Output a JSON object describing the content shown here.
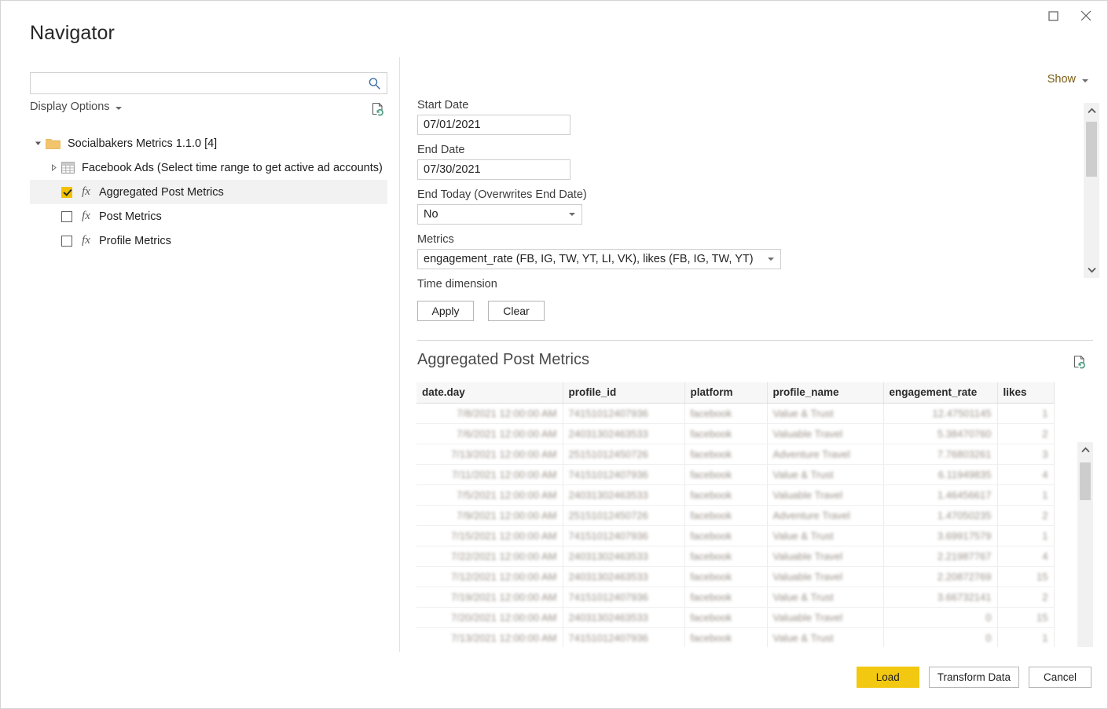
{
  "window": {
    "title": "Navigator",
    "maximize_icon": "maximize-icon",
    "close_icon": "close-icon"
  },
  "left": {
    "search": {
      "value": "",
      "placeholder": "",
      "icon": "search-icon"
    },
    "display_options_label": "Display Options",
    "refresh_icon": "refresh-document-icon",
    "tree": [
      {
        "label": "Socialbakers Metrics 1.1.0 [4]",
        "type": "folder",
        "expanded": true,
        "level": 0,
        "checkbox": false,
        "selected": false
      },
      {
        "label": "Facebook Ads (Select time range to get active ad accounts)",
        "type": "table",
        "expanded": false,
        "level": 1,
        "checkbox": false,
        "selected": false
      },
      {
        "label": "Aggregated Post Metrics",
        "type": "function",
        "level": 2,
        "checkbox": true,
        "checked": true,
        "selected": true
      },
      {
        "label": "Post Metrics",
        "type": "function",
        "level": 2,
        "checkbox": true,
        "checked": false,
        "selected": false
      },
      {
        "label": "Profile Metrics",
        "type": "function",
        "level": 2,
        "checkbox": true,
        "checked": false,
        "selected": false
      }
    ]
  },
  "right": {
    "show_label": "Show",
    "form": {
      "start_date": {
        "label": "Start Date",
        "value": "07/01/2021"
      },
      "end_date": {
        "label": "End Date",
        "value": "07/30/2021"
      },
      "end_today": {
        "label": "End Today (Overwrites End Date)",
        "value": "No"
      },
      "metrics": {
        "label": "Metrics",
        "value": "engagement_rate (FB, IG, TW, YT, LI, VK), likes (FB, IG, TW, YT)"
      },
      "time_dimension": {
        "label": "Time dimension"
      },
      "apply_label": "Apply",
      "clear_label": "Clear"
    },
    "preview": {
      "title": "Aggregated Post Metrics",
      "refresh_icon": "refresh-document-icon",
      "columns": [
        "date.day",
        "profile_id",
        "platform",
        "profile_name",
        "engagement_rate",
        "likes"
      ],
      "rows": [
        [
          "7/8/2021 12:00:00 AM",
          "74151012407936",
          "facebook",
          "Value & Trust",
          "12.47501145",
          "1"
        ],
        [
          "7/6/2021 12:00:00 AM",
          "24031302463533",
          "facebook",
          "Valuable Travel",
          "5.38470760",
          "2"
        ],
        [
          "7/13/2021 12:00:00 AM",
          "25151012450726",
          "facebook",
          "Adventure Travel",
          "7.76803261",
          "3"
        ],
        [
          "7/11/2021 12:00:00 AM",
          "74151012407936",
          "facebook",
          "Value & Trust",
          "6.11949835",
          "4"
        ],
        [
          "7/5/2021 12:00:00 AM",
          "24031302463533",
          "facebook",
          "Valuable Travel",
          "1.46456617",
          "1"
        ],
        [
          "7/9/2021 12:00:00 AM",
          "25151012450726",
          "facebook",
          "Adventure Travel",
          "1.47050235",
          "2"
        ],
        [
          "7/15/2021 12:00:00 AM",
          "74151012407936",
          "facebook",
          "Value & Trust",
          "3.69917579",
          "1"
        ],
        [
          "7/22/2021 12:00:00 AM",
          "24031302463533",
          "facebook",
          "Valuable Travel",
          "2.21987767",
          "4"
        ],
        [
          "7/12/2021 12:00:00 AM",
          "24031302463533",
          "facebook",
          "Valuable Travel",
          "2.20872769",
          "15"
        ],
        [
          "7/19/2021 12:00:00 AM",
          "74151012407936",
          "facebook",
          "Value & Trust",
          "3.66732141",
          "2"
        ],
        [
          "7/20/2021 12:00:00 AM",
          "24031302463533",
          "facebook",
          "Valuable Travel",
          "0",
          "15"
        ],
        [
          "7/13/2021 12:00:00 AM",
          "74151012407936",
          "facebook",
          "Value & Trust",
          "0",
          "1"
        ]
      ]
    }
  },
  "footer": {
    "load_label": "Load",
    "transform_label": "Transform Data",
    "cancel_label": "Cancel"
  },
  "colors": {
    "accent_yellow": "#f2c811",
    "folder_yellow": "#f2c46b",
    "search_blue": "#3b6ea5",
    "refresh_green": "#4e9e83"
  }
}
